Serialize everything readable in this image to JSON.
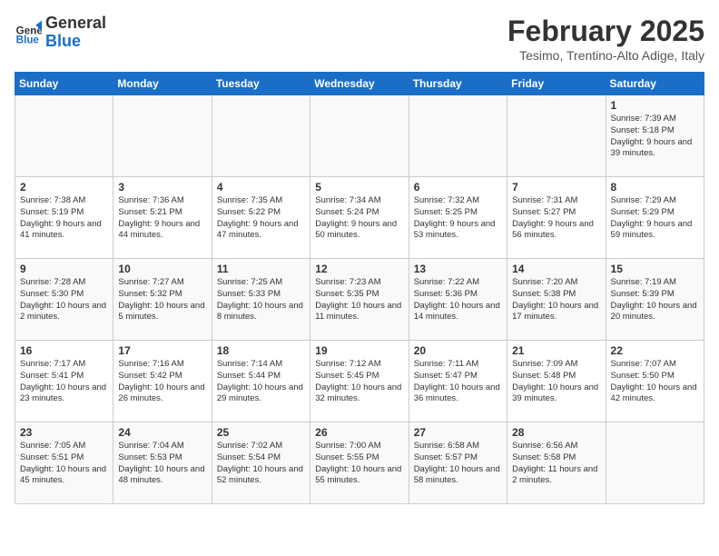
{
  "header": {
    "logo_general": "General",
    "logo_blue": "Blue",
    "title": "February 2025",
    "subtitle": "Tesimo, Trentino-Alto Adige, Italy"
  },
  "columns": [
    "Sunday",
    "Monday",
    "Tuesday",
    "Wednesday",
    "Thursday",
    "Friday",
    "Saturday"
  ],
  "weeks": [
    [
      {
        "day": "",
        "info": ""
      },
      {
        "day": "",
        "info": ""
      },
      {
        "day": "",
        "info": ""
      },
      {
        "day": "",
        "info": ""
      },
      {
        "day": "",
        "info": ""
      },
      {
        "day": "",
        "info": ""
      },
      {
        "day": "1",
        "info": "Sunrise: 7:39 AM\nSunset: 5:18 PM\nDaylight: 9 hours and 39 minutes."
      }
    ],
    [
      {
        "day": "2",
        "info": "Sunrise: 7:38 AM\nSunset: 5:19 PM\nDaylight: 9 hours and 41 minutes."
      },
      {
        "day": "3",
        "info": "Sunrise: 7:36 AM\nSunset: 5:21 PM\nDaylight: 9 hours and 44 minutes."
      },
      {
        "day": "4",
        "info": "Sunrise: 7:35 AM\nSunset: 5:22 PM\nDaylight: 9 hours and 47 minutes."
      },
      {
        "day": "5",
        "info": "Sunrise: 7:34 AM\nSunset: 5:24 PM\nDaylight: 9 hours and 50 minutes."
      },
      {
        "day": "6",
        "info": "Sunrise: 7:32 AM\nSunset: 5:25 PM\nDaylight: 9 hours and 53 minutes."
      },
      {
        "day": "7",
        "info": "Sunrise: 7:31 AM\nSunset: 5:27 PM\nDaylight: 9 hours and 56 minutes."
      },
      {
        "day": "8",
        "info": "Sunrise: 7:29 AM\nSunset: 5:29 PM\nDaylight: 9 hours and 59 minutes."
      }
    ],
    [
      {
        "day": "9",
        "info": "Sunrise: 7:28 AM\nSunset: 5:30 PM\nDaylight: 10 hours and 2 minutes."
      },
      {
        "day": "10",
        "info": "Sunrise: 7:27 AM\nSunset: 5:32 PM\nDaylight: 10 hours and 5 minutes."
      },
      {
        "day": "11",
        "info": "Sunrise: 7:25 AM\nSunset: 5:33 PM\nDaylight: 10 hours and 8 minutes."
      },
      {
        "day": "12",
        "info": "Sunrise: 7:23 AM\nSunset: 5:35 PM\nDaylight: 10 hours and 11 minutes."
      },
      {
        "day": "13",
        "info": "Sunrise: 7:22 AM\nSunset: 5:36 PM\nDaylight: 10 hours and 14 minutes."
      },
      {
        "day": "14",
        "info": "Sunrise: 7:20 AM\nSunset: 5:38 PM\nDaylight: 10 hours and 17 minutes."
      },
      {
        "day": "15",
        "info": "Sunrise: 7:19 AM\nSunset: 5:39 PM\nDaylight: 10 hours and 20 minutes."
      }
    ],
    [
      {
        "day": "16",
        "info": "Sunrise: 7:17 AM\nSunset: 5:41 PM\nDaylight: 10 hours and 23 minutes."
      },
      {
        "day": "17",
        "info": "Sunrise: 7:16 AM\nSunset: 5:42 PM\nDaylight: 10 hours and 26 minutes."
      },
      {
        "day": "18",
        "info": "Sunrise: 7:14 AM\nSunset: 5:44 PM\nDaylight: 10 hours and 29 minutes."
      },
      {
        "day": "19",
        "info": "Sunrise: 7:12 AM\nSunset: 5:45 PM\nDaylight: 10 hours and 32 minutes."
      },
      {
        "day": "20",
        "info": "Sunrise: 7:11 AM\nSunset: 5:47 PM\nDaylight: 10 hours and 36 minutes."
      },
      {
        "day": "21",
        "info": "Sunrise: 7:09 AM\nSunset: 5:48 PM\nDaylight: 10 hours and 39 minutes."
      },
      {
        "day": "22",
        "info": "Sunrise: 7:07 AM\nSunset: 5:50 PM\nDaylight: 10 hours and 42 minutes."
      }
    ],
    [
      {
        "day": "23",
        "info": "Sunrise: 7:05 AM\nSunset: 5:51 PM\nDaylight: 10 hours and 45 minutes."
      },
      {
        "day": "24",
        "info": "Sunrise: 7:04 AM\nSunset: 5:53 PM\nDaylight: 10 hours and 48 minutes."
      },
      {
        "day": "25",
        "info": "Sunrise: 7:02 AM\nSunset: 5:54 PM\nDaylight: 10 hours and 52 minutes."
      },
      {
        "day": "26",
        "info": "Sunrise: 7:00 AM\nSunset: 5:55 PM\nDaylight: 10 hours and 55 minutes."
      },
      {
        "day": "27",
        "info": "Sunrise: 6:58 AM\nSunset: 5:57 PM\nDaylight: 10 hours and 58 minutes."
      },
      {
        "day": "28",
        "info": "Sunrise: 6:56 AM\nSunset: 5:58 PM\nDaylight: 11 hours and 2 minutes."
      },
      {
        "day": "",
        "info": ""
      }
    ]
  ]
}
